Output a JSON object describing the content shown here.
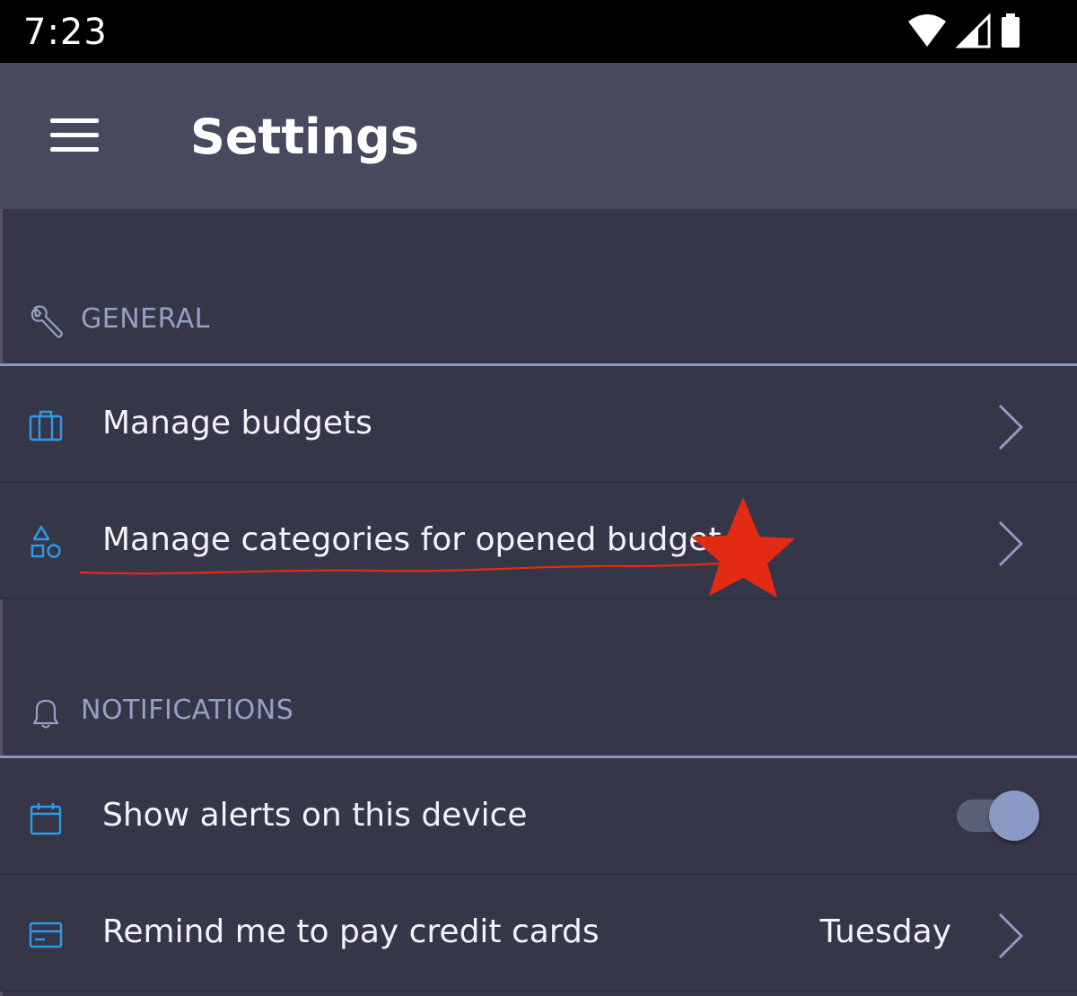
{
  "status_bar": {
    "time": "7:23",
    "icons": [
      "wifi-icon",
      "cellular-signal-icon",
      "battery-icon"
    ]
  },
  "app_bar": {
    "title": "Settings",
    "menu_icon": "hamburger-menu-icon"
  },
  "sections": {
    "general": {
      "label": "GENERAL",
      "icon": "wrench-icon",
      "items": [
        {
          "label": "Manage budgets",
          "icon": "briefcase-icon"
        },
        {
          "label": "Manage categories for opened budget",
          "icon": "shapes-icon"
        }
      ]
    },
    "notifications": {
      "label": "NOTIFICATIONS",
      "icon": "bell-icon",
      "items": [
        {
          "label": "Show alerts on this device",
          "icon": "calendar-icon",
          "toggle_on": true
        },
        {
          "label": "Remind me to pay credit cards",
          "icon": "credit-card-icon",
          "value": "Tuesday"
        }
      ]
    }
  },
  "colors": {
    "background": "#363649",
    "app_bar": "#474a5e",
    "status_bar": "#000000",
    "section_label": "#93a1c6",
    "accent_icon": "#2f9be8",
    "annotation": "#e32b14"
  }
}
